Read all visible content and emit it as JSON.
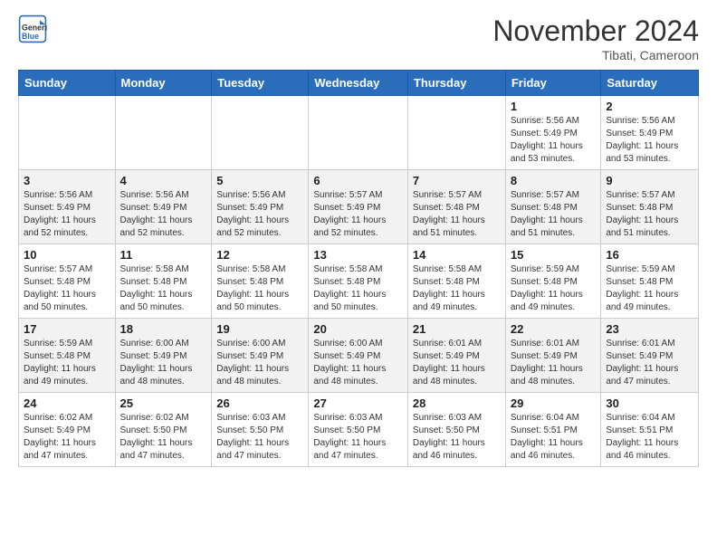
{
  "header": {
    "logo_line1": "General",
    "logo_line2": "Blue",
    "title": "November 2024",
    "subtitle": "Tibati, Cameroon"
  },
  "weekdays": [
    "Sunday",
    "Monday",
    "Tuesday",
    "Wednesday",
    "Thursday",
    "Friday",
    "Saturday"
  ],
  "weeks": [
    [
      {
        "day": "",
        "info": ""
      },
      {
        "day": "",
        "info": ""
      },
      {
        "day": "",
        "info": ""
      },
      {
        "day": "",
        "info": ""
      },
      {
        "day": "",
        "info": ""
      },
      {
        "day": "1",
        "info": "Sunrise: 5:56 AM\nSunset: 5:49 PM\nDaylight: 11 hours and 53 minutes."
      },
      {
        "day": "2",
        "info": "Sunrise: 5:56 AM\nSunset: 5:49 PM\nDaylight: 11 hours and 53 minutes."
      }
    ],
    [
      {
        "day": "3",
        "info": "Sunrise: 5:56 AM\nSunset: 5:49 PM\nDaylight: 11 hours and 52 minutes."
      },
      {
        "day": "4",
        "info": "Sunrise: 5:56 AM\nSunset: 5:49 PM\nDaylight: 11 hours and 52 minutes."
      },
      {
        "day": "5",
        "info": "Sunrise: 5:56 AM\nSunset: 5:49 PM\nDaylight: 11 hours and 52 minutes."
      },
      {
        "day": "6",
        "info": "Sunrise: 5:57 AM\nSunset: 5:49 PM\nDaylight: 11 hours and 52 minutes."
      },
      {
        "day": "7",
        "info": "Sunrise: 5:57 AM\nSunset: 5:48 PM\nDaylight: 11 hours and 51 minutes."
      },
      {
        "day": "8",
        "info": "Sunrise: 5:57 AM\nSunset: 5:48 PM\nDaylight: 11 hours and 51 minutes."
      },
      {
        "day": "9",
        "info": "Sunrise: 5:57 AM\nSunset: 5:48 PM\nDaylight: 11 hours and 51 minutes."
      }
    ],
    [
      {
        "day": "10",
        "info": "Sunrise: 5:57 AM\nSunset: 5:48 PM\nDaylight: 11 hours and 50 minutes."
      },
      {
        "day": "11",
        "info": "Sunrise: 5:58 AM\nSunset: 5:48 PM\nDaylight: 11 hours and 50 minutes."
      },
      {
        "day": "12",
        "info": "Sunrise: 5:58 AM\nSunset: 5:48 PM\nDaylight: 11 hours and 50 minutes."
      },
      {
        "day": "13",
        "info": "Sunrise: 5:58 AM\nSunset: 5:48 PM\nDaylight: 11 hours and 50 minutes."
      },
      {
        "day": "14",
        "info": "Sunrise: 5:58 AM\nSunset: 5:48 PM\nDaylight: 11 hours and 49 minutes."
      },
      {
        "day": "15",
        "info": "Sunrise: 5:59 AM\nSunset: 5:48 PM\nDaylight: 11 hours and 49 minutes."
      },
      {
        "day": "16",
        "info": "Sunrise: 5:59 AM\nSunset: 5:48 PM\nDaylight: 11 hours and 49 minutes."
      }
    ],
    [
      {
        "day": "17",
        "info": "Sunrise: 5:59 AM\nSunset: 5:48 PM\nDaylight: 11 hours and 49 minutes."
      },
      {
        "day": "18",
        "info": "Sunrise: 6:00 AM\nSunset: 5:49 PM\nDaylight: 11 hours and 48 minutes."
      },
      {
        "day": "19",
        "info": "Sunrise: 6:00 AM\nSunset: 5:49 PM\nDaylight: 11 hours and 48 minutes."
      },
      {
        "day": "20",
        "info": "Sunrise: 6:00 AM\nSunset: 5:49 PM\nDaylight: 11 hours and 48 minutes."
      },
      {
        "day": "21",
        "info": "Sunrise: 6:01 AM\nSunset: 5:49 PM\nDaylight: 11 hours and 48 minutes."
      },
      {
        "day": "22",
        "info": "Sunrise: 6:01 AM\nSunset: 5:49 PM\nDaylight: 11 hours and 48 minutes."
      },
      {
        "day": "23",
        "info": "Sunrise: 6:01 AM\nSunset: 5:49 PM\nDaylight: 11 hours and 47 minutes."
      }
    ],
    [
      {
        "day": "24",
        "info": "Sunrise: 6:02 AM\nSunset: 5:49 PM\nDaylight: 11 hours and 47 minutes."
      },
      {
        "day": "25",
        "info": "Sunrise: 6:02 AM\nSunset: 5:50 PM\nDaylight: 11 hours and 47 minutes."
      },
      {
        "day": "26",
        "info": "Sunrise: 6:03 AM\nSunset: 5:50 PM\nDaylight: 11 hours and 47 minutes."
      },
      {
        "day": "27",
        "info": "Sunrise: 6:03 AM\nSunset: 5:50 PM\nDaylight: 11 hours and 47 minutes."
      },
      {
        "day": "28",
        "info": "Sunrise: 6:03 AM\nSunset: 5:50 PM\nDaylight: 11 hours and 46 minutes."
      },
      {
        "day": "29",
        "info": "Sunrise: 6:04 AM\nSunset: 5:51 PM\nDaylight: 11 hours and 46 minutes."
      },
      {
        "day": "30",
        "info": "Sunrise: 6:04 AM\nSunset: 5:51 PM\nDaylight: 11 hours and 46 minutes."
      }
    ]
  ]
}
